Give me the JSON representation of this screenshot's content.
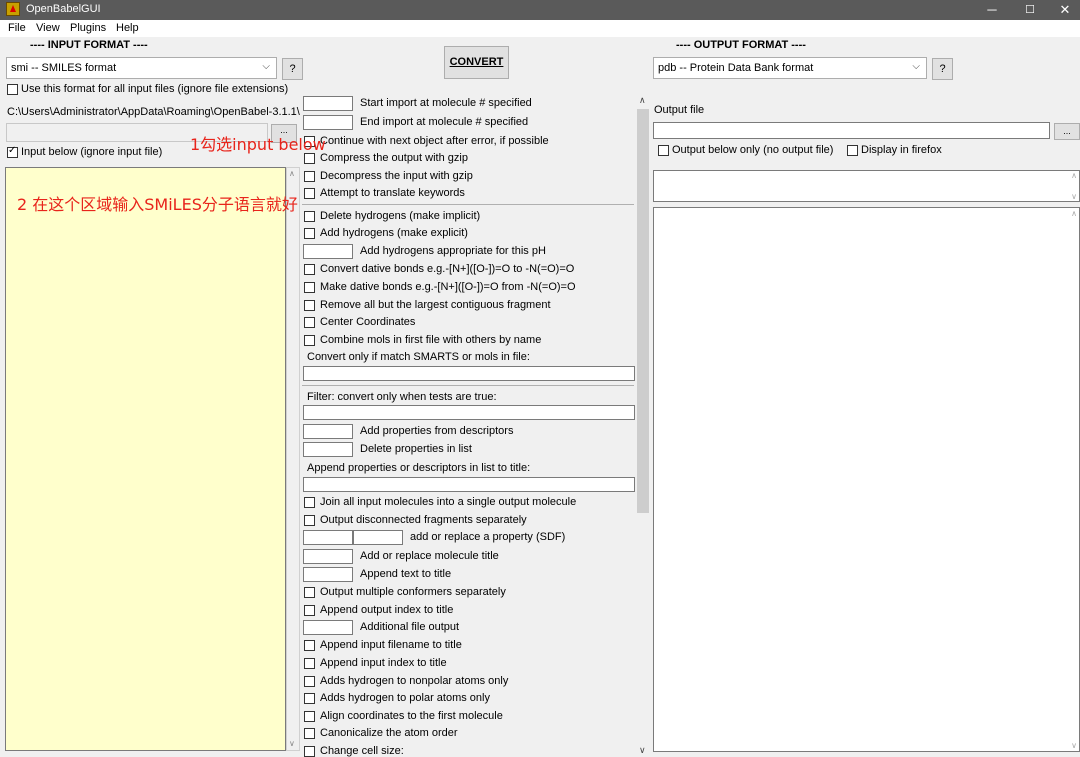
{
  "titlebar": {
    "title": "OpenBabelGUI",
    "min": "─",
    "max": "☐",
    "close": "✕"
  },
  "menu": {
    "file": "File",
    "view": "View",
    "plugins": "Plugins",
    "help": "Help"
  },
  "input": {
    "section_title": "---- INPUT FORMAT ----",
    "format_value": "smi -- SMILES format",
    "help": "?",
    "use_for_all": "Use this format for all input files (ignore file extensions)",
    "path": "C:\\Users\\Administrator\\AppData\\Roaming\\OpenBabel-3.1.1\\",
    "browse": "...",
    "input_below": "Input below (ignore input file)",
    "input_below_checked": true,
    "use_for_all_checked": false
  },
  "convert_label": "CONVERT",
  "output": {
    "section_title": "---- OUTPUT FORMAT ----",
    "format_value": "pdb -- Protein Data Bank format",
    "help": "?",
    "output_file_label": "Output file",
    "browse": "...",
    "output_below": "Output below only (no output file)",
    "display_firefox": "Display in firefox"
  },
  "options": {
    "start_import": "Start import at molecule # specified",
    "end_import": "End import at molecule # specified",
    "continue_error": "Continue with next object after error, if possible",
    "compress_gzip": "Compress the output with gzip",
    "decompress_gzip": "Decompress the input with gzip",
    "translate_keywords": "Attempt to translate keywords",
    "delete_h": "Delete hydrogens (make implicit)",
    "add_h": "Add hydrogens (make explicit)",
    "add_h_ph": "Add hydrogens appropriate for this pH",
    "convert_dative": "Convert dative bonds e.g.-[N+]([O-])=O to -N(=O)=O",
    "make_dative": "Make dative bonds e.g.-[N+]([O-])=O from -N(=O)=O",
    "remove_largest": "Remove all but the largest contiguous fragment",
    "center_coords": "Center Coordinates",
    "combine_mols": "Combine mols in first file with others by name",
    "convert_smarts": "Convert only if match SMARTS or mols in file:",
    "filter": "Filter: convert only when tests are true:",
    "add_props": "Add properties from descriptors",
    "delete_props": "Delete properties in list",
    "append_props": "Append properties or descriptors in list to title:",
    "join_all": "Join all input molecules into a single output molecule",
    "output_disconnected": "Output disconnected fragments separately",
    "add_replace_prop": "add or replace a property (SDF)",
    "add_replace_title": "Add or replace molecule title",
    "append_text": "Append text to title",
    "output_conformers": "Output multiple conformers separately",
    "append_output_index": "Append output index to title",
    "additional_output": "Additional file output",
    "append_filename": "Append input filename to title",
    "append_input_index": "Append input index to title",
    "h_nonpolar": "Adds hydrogen to nonpolar atoms only",
    "h_polar": "Adds hydrogen to polar atoms only",
    "align_coords": "Align coordinates to the first molecule",
    "canonicalize": "Canonicalize the atom order",
    "change_cell": "Change cell size:"
  },
  "annotations": {
    "step1": "1勾选input below",
    "step2": "2 在这个区域输入SMiLES分子语言就好"
  },
  "colors": {
    "input_area": "#ffffcc",
    "annotation": "#e8241b",
    "titlebar": "#5a5a5a"
  }
}
